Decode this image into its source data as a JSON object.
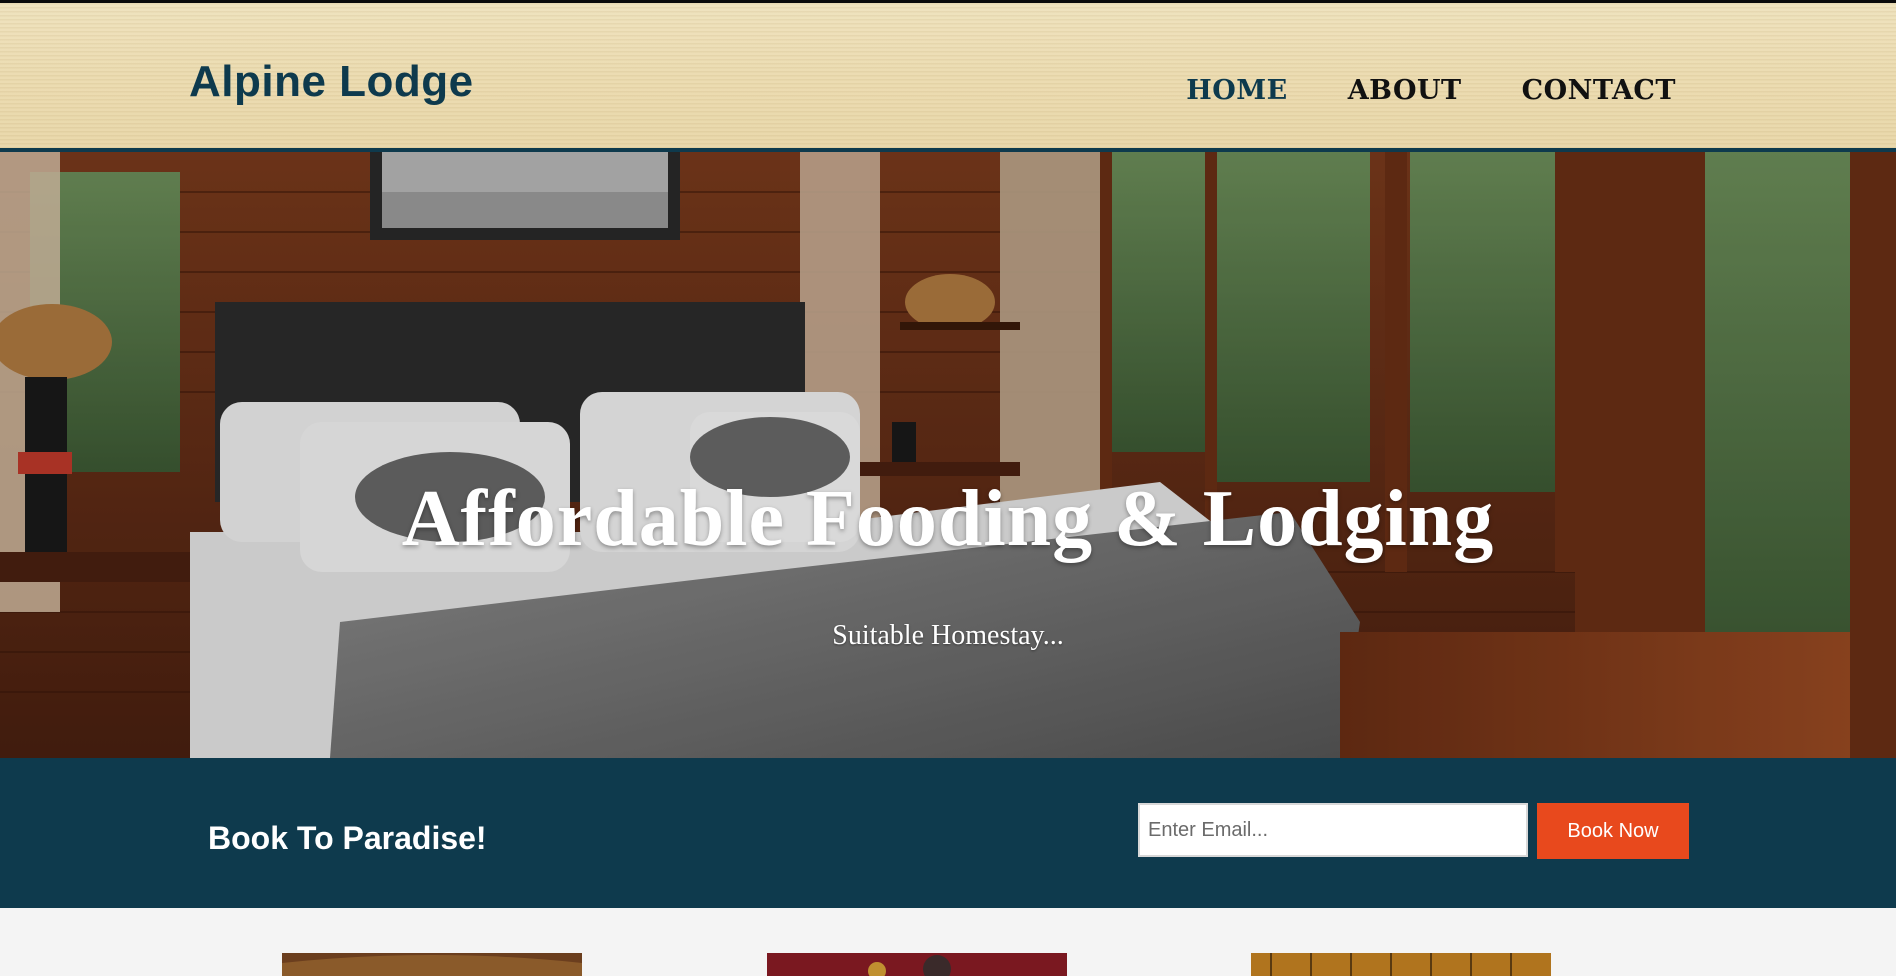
{
  "header": {
    "logo": "Alpine Lodge",
    "nav": [
      {
        "label": "HOME",
        "active": true
      },
      {
        "label": "ABOUT",
        "active": false
      },
      {
        "label": "CONTACT",
        "active": false
      }
    ]
  },
  "hero": {
    "title": "Affordable Fooding & Lodging",
    "subtitle": "Suitable Homestay..."
  },
  "booking": {
    "title": "Book To Paradise!",
    "email_placeholder": "Enter Email...",
    "button_label": "Book Now"
  },
  "colors": {
    "brand": "#0e3a4d",
    "accent": "#e8491d",
    "header_bg": "#ecdcb2"
  }
}
